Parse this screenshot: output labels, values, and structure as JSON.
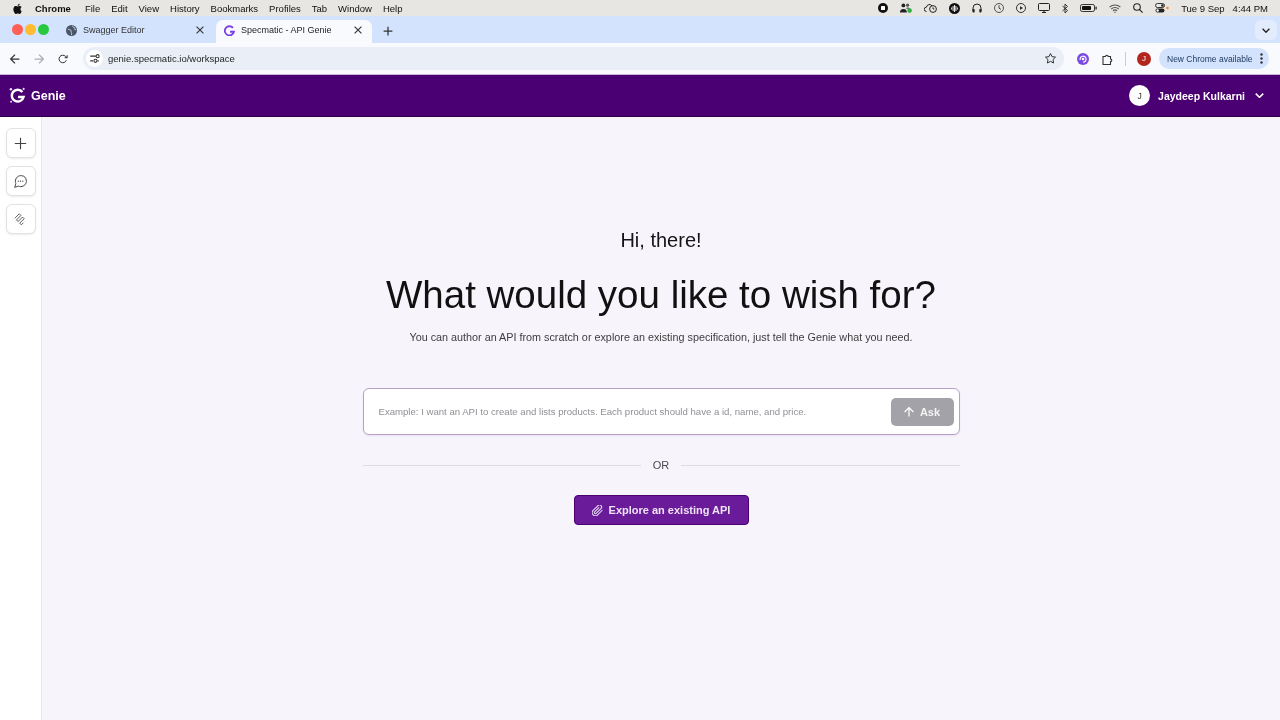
{
  "menu_bar": {
    "app": "Chrome",
    "menus": [
      "File",
      "Edit",
      "View",
      "History",
      "Bookmarks",
      "Profiles",
      "Tab",
      "Window",
      "Help"
    ],
    "date": "Tue 9 Sep",
    "time": "4:44 PM"
  },
  "browser": {
    "tabs": [
      {
        "title": "Swagger Editor",
        "selected": false
      },
      {
        "title": "Specmatic - API Genie",
        "selected": true
      }
    ],
    "forward_disabled": true,
    "url": "genie.specmatic.io/workspace",
    "profile_initial": "J",
    "update_label": "New Chrome available"
  },
  "app_header": {
    "brand": "Genie",
    "user_initial": "J",
    "user_name": "Jaydeep Kulkarni"
  },
  "welcome": {
    "greeting": "Hi, there!",
    "heading": "What would you like to wish for?",
    "subtitle": "You can author an API from scratch or explore an existing specification, just tell the Genie what you need."
  },
  "prompt": {
    "placeholder": "Example: I want an API to create and lists products. Each product should have a id, name, and price.",
    "submit": {
      "label": "Ask",
      "disabled": true
    }
  },
  "divider_label": "OR",
  "explore_button": {
    "label": "Explore an existing API"
  }
}
